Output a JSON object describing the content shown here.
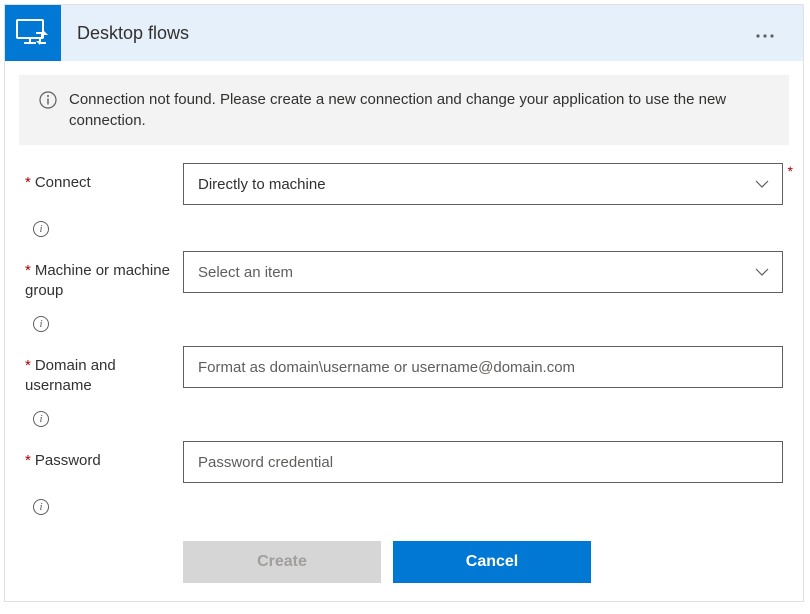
{
  "header": {
    "title": "Desktop flows"
  },
  "warning": {
    "message": "Connection not found. Please create a new connection and change your application to use the new connection."
  },
  "fields": {
    "connect": {
      "label": "Connect",
      "value": "Directly to machine"
    },
    "machine": {
      "label": "Machine or machine group",
      "placeholder": "Select an item"
    },
    "domain": {
      "label": "Domain and username",
      "placeholder": "Format as domain\\username or username@domain.com"
    },
    "password": {
      "label": "Password",
      "placeholder": "Password credential"
    }
  },
  "buttons": {
    "create": "Create",
    "cancel": "Cancel"
  }
}
